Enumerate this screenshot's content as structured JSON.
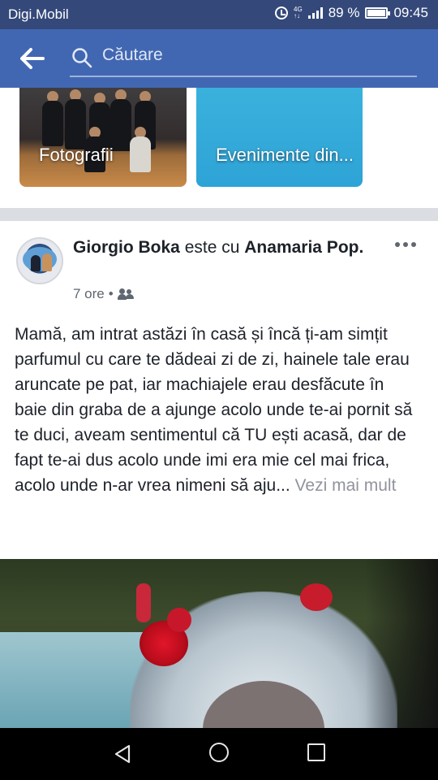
{
  "status_bar": {
    "carrier": "Digi.Mobil",
    "network": "4G",
    "battery_percent": "89 %",
    "battery_level": 0.89,
    "time": "09:45"
  },
  "app_bar": {
    "search_placeholder": "Căutare",
    "back_icon": "arrow-left-icon",
    "search_icon": "magnifier-icon"
  },
  "photo_cards": [
    {
      "label": "Fotografii"
    },
    {
      "label": "Evenimente din..."
    }
  ],
  "post": {
    "author": "Giorgio Boka",
    "connector": "este cu",
    "tagged": "Anamaria Pop",
    "time": "7 ore",
    "separator": "•",
    "audience_icon": "friends-icon",
    "text": "Mamă, am intrat astăzi în casă și încă ți-am simțit parfumul cu care te dădeai zi de zi, hainele tale erau aruncate pe pat, iar machiajele erau desfăcute în baie din graba de a ajunge acolo unde te-ai pornit să te duci, aveam sentimentul că TU ești acasă, dar de fapt te-ai dus acolo unde imi era mie cel mai frica, acolo unde n-ar vrea nimeni să aju...",
    "see_more": "Vezi mai mult"
  },
  "colors": {
    "status_bar": "#34497a",
    "app_bar": "#4267b2",
    "events_card": "#34a9da",
    "divider": "#dadde1"
  }
}
